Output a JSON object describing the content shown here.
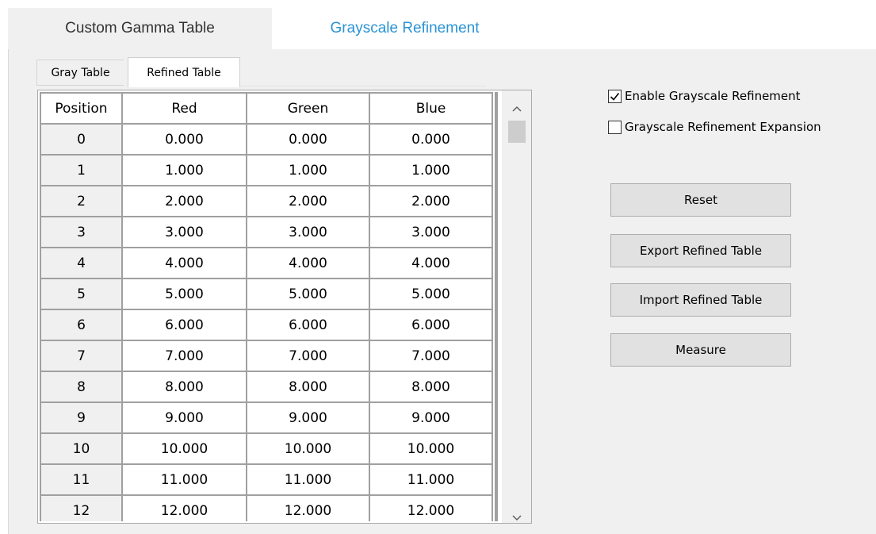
{
  "top_tabs": [
    {
      "label": "Custom Gamma Table",
      "active": false
    },
    {
      "label": "Grayscale Refinement",
      "active": true
    }
  ],
  "sub_tabs": [
    {
      "label": "Gray Table",
      "active": false
    },
    {
      "label": "Refined Table",
      "active": true
    }
  ],
  "table": {
    "headers": [
      "Position",
      "Red",
      "Green",
      "Blue"
    ],
    "rows": [
      [
        "0",
        "0.000",
        "0.000",
        "0.000"
      ],
      [
        "1",
        "1.000",
        "1.000",
        "1.000"
      ],
      [
        "2",
        "2.000",
        "2.000",
        "2.000"
      ],
      [
        "3",
        "3.000",
        "3.000",
        "3.000"
      ],
      [
        "4",
        "4.000",
        "4.000",
        "4.000"
      ],
      [
        "5",
        "5.000",
        "5.000",
        "5.000"
      ],
      [
        "6",
        "6.000",
        "6.000",
        "6.000"
      ],
      [
        "7",
        "7.000",
        "7.000",
        "7.000"
      ],
      [
        "8",
        "8.000",
        "8.000",
        "8.000"
      ],
      [
        "9",
        "9.000",
        "9.000",
        "9.000"
      ],
      [
        "10",
        "10.000",
        "10.000",
        "10.000"
      ],
      [
        "11",
        "11.000",
        "11.000",
        "11.000"
      ],
      [
        "12",
        "12.000",
        "12.000",
        "12.000"
      ]
    ]
  },
  "options": {
    "enable_refinement": {
      "label": "Enable Grayscale Refinement",
      "checked": true
    },
    "refinement_expansion": {
      "label": "Grayscale Refinement Expansion",
      "checked": false
    }
  },
  "buttons": {
    "reset": "Reset",
    "export": "Export Refined Table",
    "import": "Import Refined Table",
    "measure": "Measure"
  },
  "icons": {
    "scroll_up": "chevron-up-icon",
    "scroll_down": "chevron-down-icon",
    "check": "check-icon"
  },
  "colors": {
    "active_tab_text": "#2b93d5",
    "panel_background": "#f0f0f0"
  }
}
